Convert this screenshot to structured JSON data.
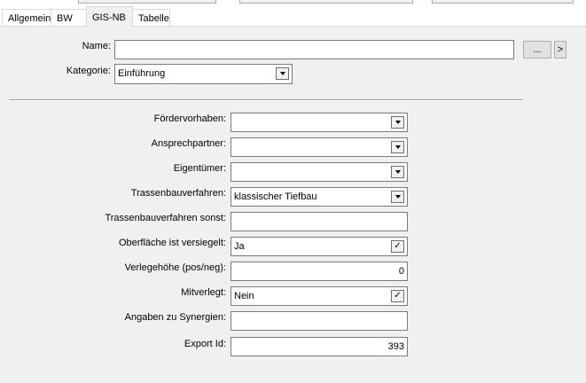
{
  "tabs": [
    {
      "label": "Allgemein"
    },
    {
      "label": "BW"
    },
    {
      "label": "GIS-NB"
    },
    {
      "label": "Tabelle"
    }
  ],
  "header": {
    "name_label": "Name:",
    "name_value": "",
    "browse_label": "...",
    "arrow_label": ">",
    "kategorie_label": "Kategorie:",
    "kategorie_value": "Einführung"
  },
  "form": [
    {
      "label": "Fördervorhaben:",
      "value": "",
      "kind": "dropdown"
    },
    {
      "label": "Ansprechpartner:",
      "value": "",
      "kind": "dropdown"
    },
    {
      "label": "Eigentümer:",
      "value": "",
      "kind": "dropdown"
    },
    {
      "label": "Trassenbauverfahren:",
      "value": "klassischer Tiefbau",
      "kind": "dropdown"
    },
    {
      "label": "Trassenbauverfahren sonst:",
      "value": "",
      "kind": "text"
    },
    {
      "label": "Oberfläche ist versiegelt:",
      "value": "Ja",
      "kind": "check"
    },
    {
      "label": "Verlegehöhe (pos/neg):",
      "value": "0",
      "kind": "number"
    },
    {
      "label": "Mitverlegt:",
      "value": "Nein",
      "kind": "check"
    },
    {
      "label": "Angaben zu Synergien:",
      "value": "",
      "kind": "text"
    },
    {
      "label": "Export Id:",
      "value": "393",
      "kind": "number"
    }
  ],
  "icons": {
    "dropdown": "chevron-down-icon",
    "check": "checkmark-icon"
  }
}
